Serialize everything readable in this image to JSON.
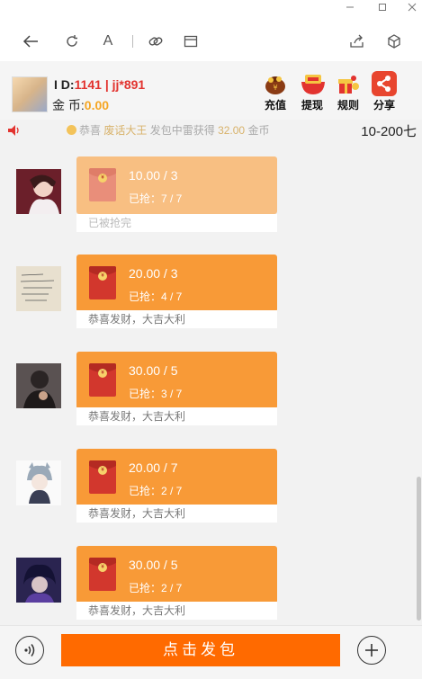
{
  "window": {
    "minimize_icon": "minimize-icon",
    "maximize_icon": "maximize-icon",
    "close_icon": "close-icon"
  },
  "toolbar": {
    "font_label": "A",
    "icons": [
      "back-arrow-icon",
      "refresh-icon",
      "font-size-icon",
      "link-icon",
      "window-icon",
      "share-icon",
      "cube-icon"
    ]
  },
  "header": {
    "id_prefix": "I  D:",
    "id_value": "1141 | jj*891",
    "coin_label": "金 币:",
    "coin_value": "0.00",
    "buttons": [
      {
        "label": "充值",
        "icon": "money-bag-icon"
      },
      {
        "label": "提现",
        "icon": "red-envelope-bowl-icon"
      },
      {
        "label": "规则",
        "icon": "gift-icon"
      },
      {
        "label": "分享",
        "icon": "share-icon"
      }
    ]
  },
  "notice": {
    "prefix": "恭喜",
    "name": "废话大王",
    "middle": "发包中雷获得",
    "amount": "32.00",
    "suffix": "金币",
    "range": "10-200七"
  },
  "messages": [
    {
      "amount": "10.00 / 3",
      "grabbed": "已抢：7 / 7",
      "footer": "已被抢完",
      "done": true
    },
    {
      "amount": "20.00 / 3",
      "grabbed": "已抢：4 / 7",
      "footer": "恭喜发财，大吉大利",
      "done": false
    },
    {
      "amount": "30.00 / 5",
      "grabbed": "已抢：3 / 7",
      "footer": "恭喜发财，大吉大利",
      "done": false
    },
    {
      "amount": "20.00 / 7",
      "grabbed": "已抢：2 / 7",
      "footer": "恭喜发财，大吉大利",
      "done": false
    },
    {
      "amount": "30.00 / 5",
      "grabbed": "已抢：2 / 7",
      "footer": "恭喜发财，大吉大利",
      "done": false
    }
  ],
  "bottom": {
    "send_label": "点击发包",
    "voice_icon": "voice-icon",
    "plus_icon": "plus-icon"
  },
  "colors": {
    "accent": "#ff6a00",
    "card": "#f89a37",
    "card_done": "#f8bf82",
    "id_red": "#e2332f",
    "coin_orange": "#f5a623"
  }
}
